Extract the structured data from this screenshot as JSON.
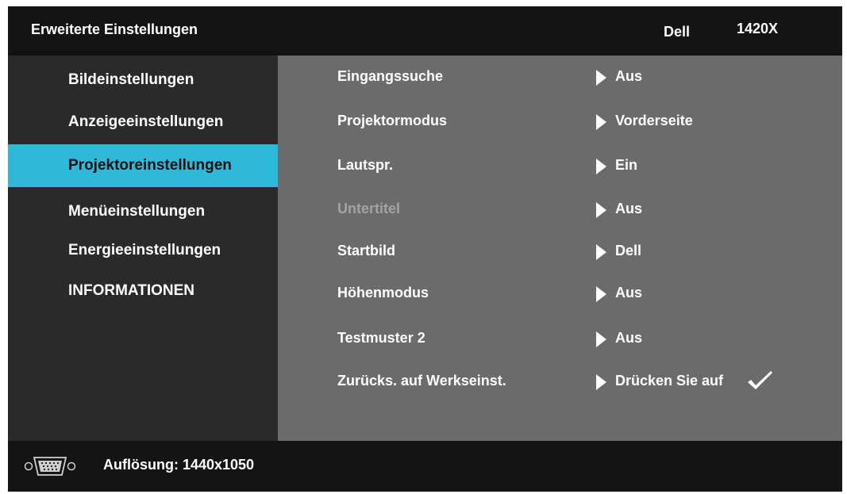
{
  "header": {
    "title": "Erweiterte Einstellungen",
    "brand": "Dell",
    "model": "1420X"
  },
  "sidebar": {
    "items": [
      {
        "label": "Bildeinstellungen",
        "active": false
      },
      {
        "label": "Anzeigeeinstellungen",
        "active": false
      },
      {
        "label": "Projektoreinstellungen",
        "active": true
      },
      {
        "label": "Menüeinstellungen",
        "active": false
      },
      {
        "label": "Energieeinstellungen",
        "active": false
      },
      {
        "label": "INFORMATIONEN",
        "active": false
      }
    ]
  },
  "settings": {
    "rows": [
      {
        "label": "Eingangssuche",
        "value": "Aus",
        "disabled": false
      },
      {
        "label": "Projektormodus",
        "value": "Vorderseite",
        "disabled": false
      },
      {
        "label": "Lautspr.",
        "value": "Ein",
        "disabled": false
      },
      {
        "label": "Untertitel",
        "value": "Aus",
        "disabled": true
      },
      {
        "label": "Startbild",
        "value": "Dell",
        "disabled": false
      },
      {
        "label": "Höhenmodus",
        "value": "Aus",
        "disabled": false
      },
      {
        "label": "Testmuster 2",
        "value": "Aus",
        "disabled": false
      },
      {
        "label": "Zurücks. auf Werkseinst.",
        "value": "Drücken Sie auf",
        "disabled": false,
        "icon": "checkmark-icon"
      }
    ]
  },
  "status": {
    "resolution": "Auflösung: 1440x1050",
    "icon": "vga-connector-icon"
  },
  "colors": {
    "accent": "#2eb8d9",
    "sidebar_bg": "#2a2a2a",
    "content_bg": "#6b6b6b",
    "bar_bg": "#141414",
    "disabled_text": "#a3a3a3"
  }
}
